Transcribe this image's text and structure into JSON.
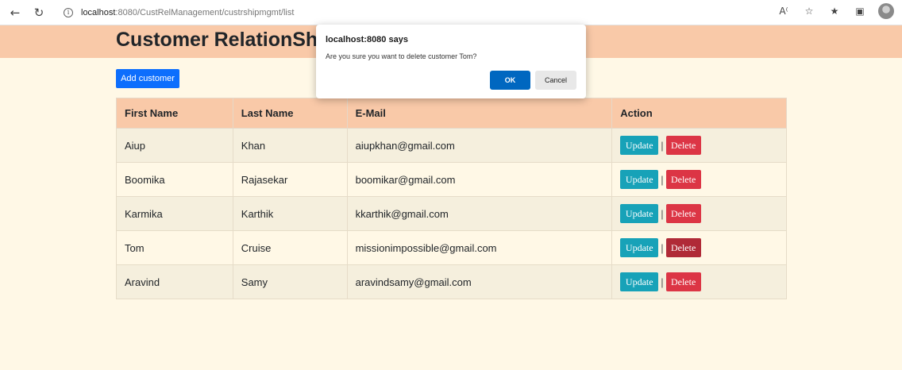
{
  "browser": {
    "url_host": "localhost",
    "url_rest": ":8080/CustRelManagement/custrshipmgmt/list",
    "icons": [
      "back-arrow-icon",
      "refresh-icon",
      "info-icon",
      "read-aloud-icon",
      "favorite-add-icon",
      "favorites-icon",
      "collections-icon",
      "profile-avatar"
    ]
  },
  "page": {
    "title": "Customer RelationShip",
    "add_button": "Add customer"
  },
  "table": {
    "headers": [
      "First Name",
      "Last Name",
      "E-Mail",
      "Action"
    ],
    "rows": [
      {
        "first": "Aiup",
        "last": "Khan",
        "email": "aiupkhan@gmail.com"
      },
      {
        "first": "Boomika",
        "last": "Rajasekar",
        "email": "boomikar@gmail.com"
      },
      {
        "first": "Karmika",
        "last": "Karthik",
        "email": "kkarthik@gmail.com"
      },
      {
        "first": "Tom",
        "last": "Cruise",
        "email": "missionimpossible@gmail.com"
      },
      {
        "first": "Aravind",
        "last": "Samy",
        "email": "aravindsamy@gmail.com"
      }
    ],
    "update_label": "Update",
    "separator": "|",
    "delete_label": "Delete"
  },
  "dialog": {
    "title": "localhost:8080 says",
    "message": "Are you sure you want to delete customer Tom?",
    "ok": "OK",
    "cancel": "Cancel"
  },
  "colors": {
    "header": "#f9c9a8",
    "background": "#fff8e6",
    "primary": "#0d6efd",
    "update": "#17a2b8",
    "delete": "#dc3545",
    "dialog_ok": "#0067c0"
  }
}
